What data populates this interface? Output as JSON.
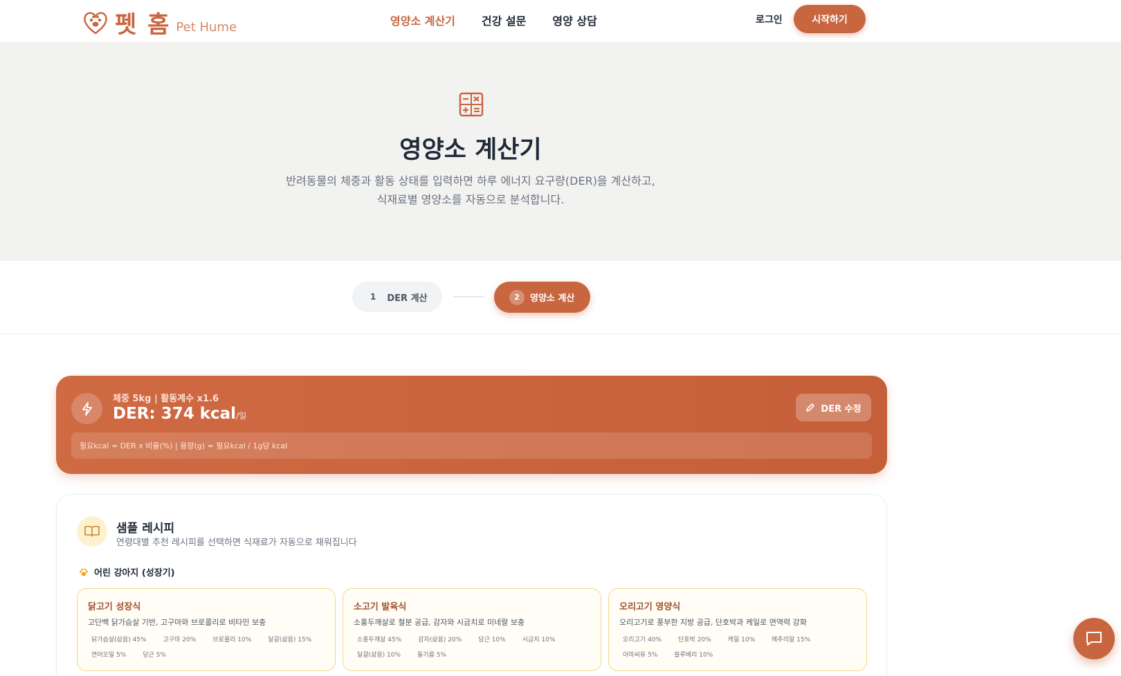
{
  "brand": {
    "name_ko": "펫 홈",
    "name_en": "Pet Hume"
  },
  "nav": {
    "items": [
      {
        "label": "영양소 계산기",
        "active": true
      },
      {
        "label": "건강 설문",
        "active": false
      },
      {
        "label": "영양 상담",
        "active": false
      }
    ],
    "login": "로그인",
    "start": "시작하기"
  },
  "hero": {
    "icon": "calculator-icon",
    "title": "영양소 계산기",
    "desc_line1": "반려동물의 체중과 활동 상태를 입력하면 하루 에너지 요구량(DER)을 계산하고,",
    "desc_line2": "식재료별 영양소를 자동으로 분석합니다."
  },
  "steps": [
    {
      "num": "1",
      "label": "DER 계산",
      "active": false
    },
    {
      "num": "2",
      "label": "영양소 계산",
      "active": true
    }
  ],
  "der": {
    "subtitle": "체중 5kg | 활동계수 x1.6",
    "value": "DER: 374 kcal",
    "unit": "/일",
    "edit": "DER 수정",
    "formula": "필요kcal = DER x 비율(%)  |  용량(g) = 필요kcal / 1g당 kcal"
  },
  "recipes": {
    "title": "샘플 레시피",
    "desc": "연령대별 추천 레시피를 선택하면 식재료가 자동으로 채워집니다",
    "age_group": "어린 강아지 (성장기)",
    "cards": [
      {
        "name": "닭고기 성장식",
        "desc": "고단백 닭가슴살 기반, 고구마와 브로콜리로 비타민 보충",
        "tags": [
          "닭가슴살(삶음) 45%",
          "고구마 20%",
          "브로콜리 10%",
          "달걀(삶음) 15%",
          "연어오일 5%",
          "당근 5%"
        ]
      },
      {
        "name": "소고기 발육식",
        "desc": "소홍두깨살로 철분 공급, 감자와 시금치로 미네랄 보충",
        "tags": [
          "소홍두깨살 45%",
          "감자(삶음) 20%",
          "당근 10%",
          "시금치 10%",
          "달걀(삶음) 10%",
          "들기름 5%"
        ]
      },
      {
        "name": "오리고기 영양식",
        "desc": "오리고기로 풍부한 지방 공급, 단호박과 케일로 면역력 강화",
        "tags": [
          "오리고기 40%",
          "단호박 20%",
          "케일 10%",
          "메추리알 15%",
          "아마씨유 5%",
          "블루베리 10%"
        ]
      }
    ]
  },
  "colors": {
    "accent": "#c8663f",
    "hero_bg": "#f2f2f1",
    "card_border": "#f4d68a"
  }
}
